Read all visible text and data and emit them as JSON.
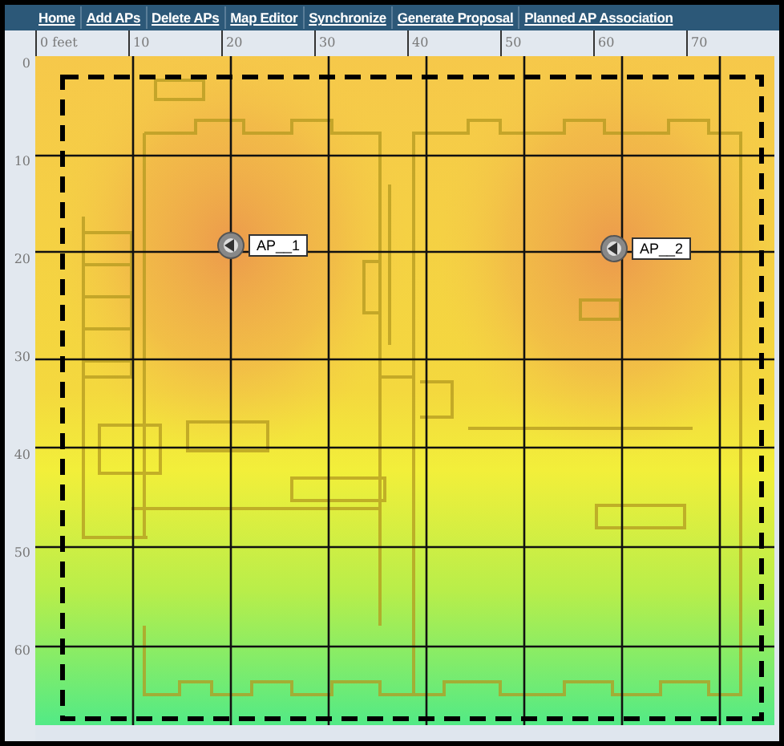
{
  "nav": [
    {
      "label": "Home"
    },
    {
      "label": "Add APs"
    },
    {
      "label": "Delete APs"
    },
    {
      "label": "Map Editor"
    },
    {
      "label": "Synchronize"
    },
    {
      "label": "Generate Proposal"
    },
    {
      "label": "Planned AP Association"
    }
  ],
  "ruler": {
    "x_ticks": [
      "0 feet",
      "10",
      "20",
      "30",
      "40",
      "50",
      "60",
      "70"
    ],
    "y_ticks": [
      "0",
      "10",
      "20",
      "30",
      "40",
      "50",
      "60"
    ]
  },
  "access_points": [
    {
      "label": "AP__1"
    },
    {
      "label": "AP__2"
    }
  ]
}
